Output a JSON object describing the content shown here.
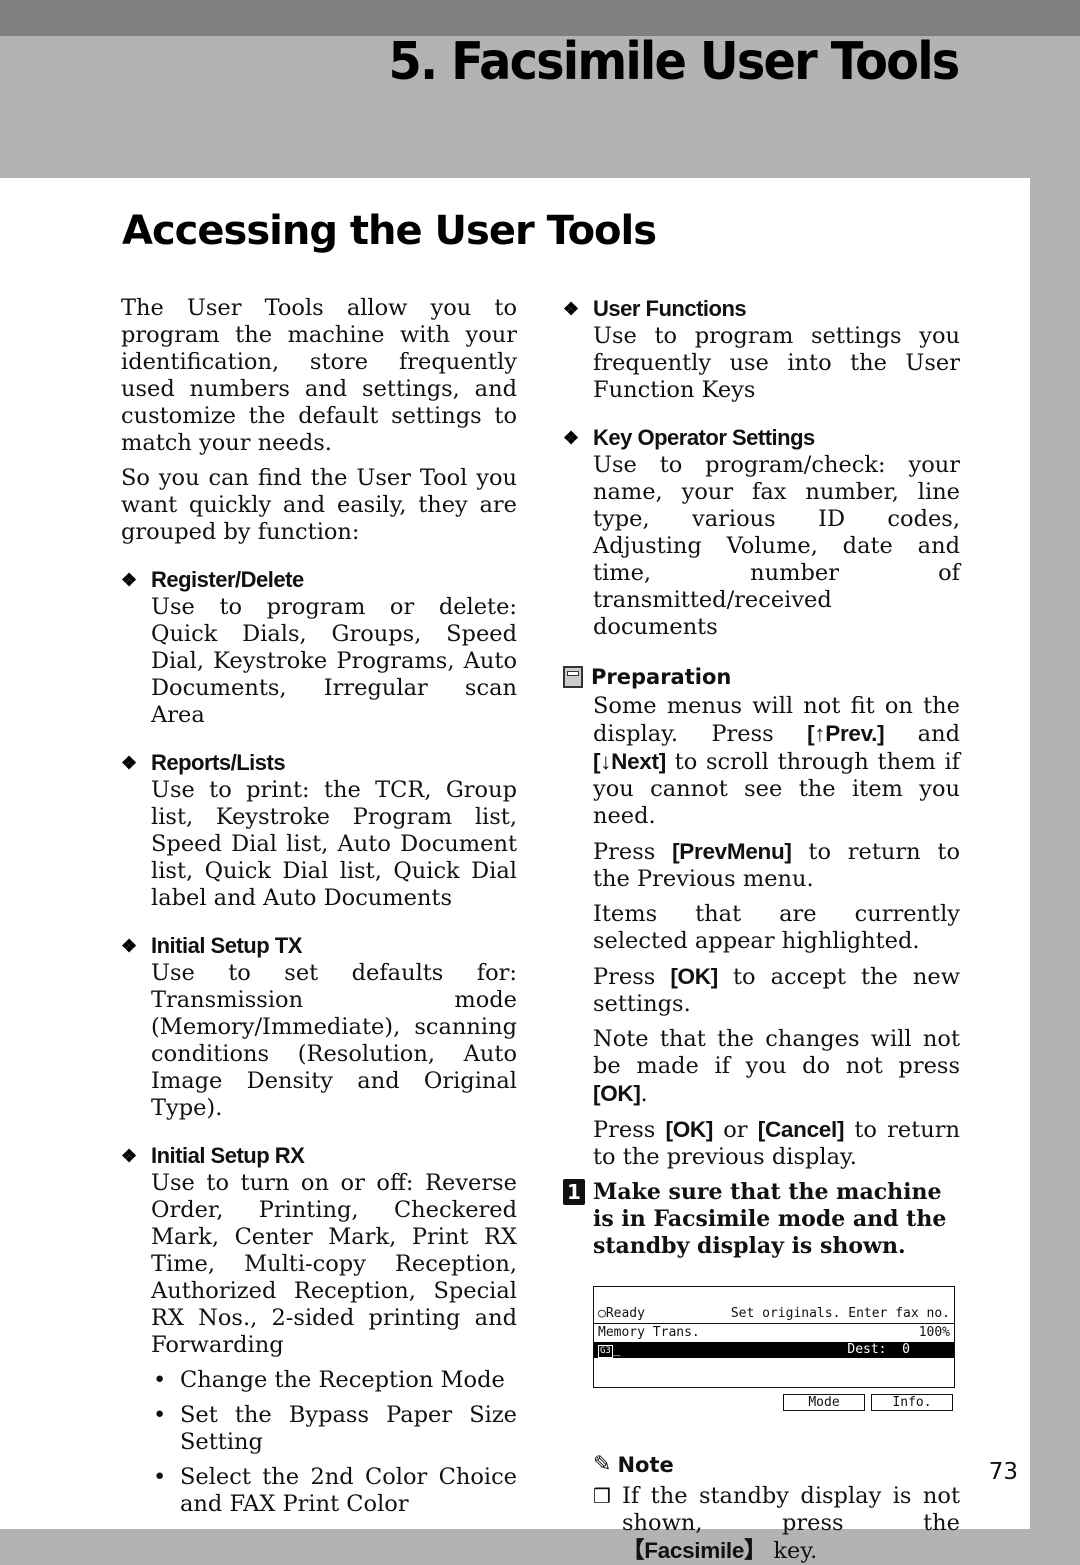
{
  "chapter_title": "5. Facsimile User Tools",
  "section_title": "Accessing the User Tools",
  "intro_paragraphs": [
    "The User Tools allow you to program the machine with your identification, store frequently used numbers and settings, and customize the default settings to match your needs.",
    "So you can find the User Tool you want quickly and easily, they are grouped by function:"
  ],
  "left_items": [
    {
      "title": "Register/Delete",
      "body": "Use to program or delete: Quick Dials, Groups, Speed Dial, Keystroke Programs, Auto Documents, Irregular scan Area"
    },
    {
      "title": "Reports/Lists",
      "body": "Use to print: the TCR, Group list, Keystroke Program list, Speed Dial list, Auto Document list, Quick Dial list, Quick Dial label and Auto Documents"
    },
    {
      "title": "Initial Setup TX",
      "body": "Use to set defaults for: Transmission mode (Memory/Immediate), scanning conditions (Resolution, Auto Image Density and Original Type)."
    },
    {
      "title": "Initial Setup RX",
      "body": "Use to turn on or off: Reverse Order, Printing, Checkered Mark, Center Mark, Print RX Time, Multi-copy Reception, Authorized Reception, Special RX Nos., 2-sided printing and Forwarding"
    }
  ],
  "rx_bullets": [
    "Change the Reception Mode",
    "Set the Bypass Paper Size Setting",
    "Select the 2nd Color Choice and FAX Print Color"
  ],
  "right_items": [
    {
      "title": "User Functions",
      "body": "Use to program settings you frequently use into the User Function Keys"
    },
    {
      "title": "Key Operator Settings",
      "body": "Use to program/check: your name, your fax number, line type, various ID codes, Adjusting Volume, date and time, number of transmitted/received documents"
    }
  ],
  "preparation": {
    "title": "Preparation",
    "p1_a": "Some menus will not fit on the display. Press ",
    "p1_key1": "[↑Prev.]",
    "p1_b": " and ",
    "p1_key2": "[↓Next]",
    "p1_c": " to scroll through them if you cannot see the item you need.",
    "p2_a": "Press ",
    "p2_key": "[PrevMenu]",
    "p2_b": " to return to the Previous menu.",
    "p3": "Items that are currently selected appear highlighted.",
    "p4_a": "Press ",
    "p4_key": "[OK]",
    "p4_b": " to accept the new settings.",
    "p5_a": "Note that the changes will not be made if you do not press ",
    "p5_key": "[OK]",
    "p5_b": ".",
    "p6_a": "Press ",
    "p6_key1": "[OK]",
    "p6_b": " or ",
    "p6_key2": "[Cancel]",
    "p6_c": " to return to the previous display."
  },
  "step": {
    "number": "1",
    "text": "Make sure that the machine is in Facsimile mode and the standby display is shown."
  },
  "lcd": {
    "status": "○Ready",
    "message": "Set originals. Enter fax no.",
    "mode": "Memory Trans.",
    "scale": "100%",
    "line_icon": "G3",
    "cursor": "_",
    "dest": "Dest:  0",
    "buttons": [
      "Mode",
      "Info."
    ]
  },
  "note": {
    "title": "Note",
    "text_a": "If the standby display is not shown, press the ",
    "key": "【Facsimile】",
    "text_b": " key."
  },
  "page_number": "73"
}
